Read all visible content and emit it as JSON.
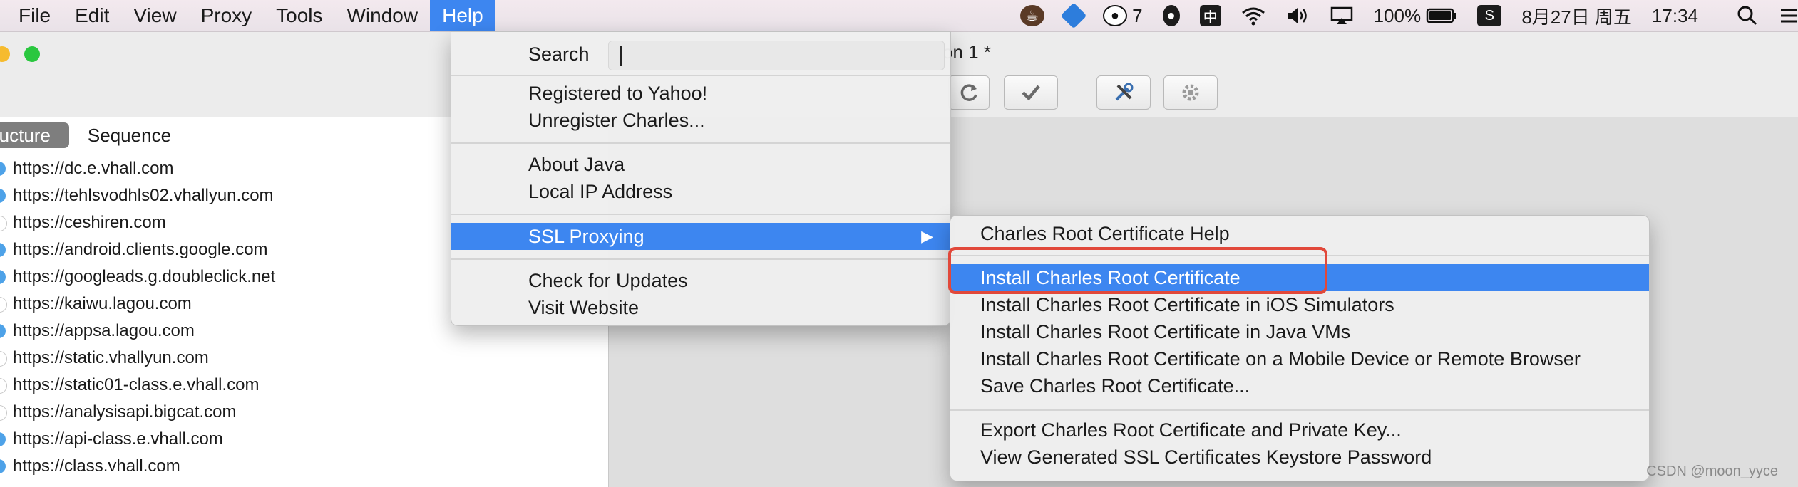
{
  "menubar": {
    "items": [
      "File",
      "Edit",
      "View",
      "Proxy",
      "Tools",
      "Window",
      "Help"
    ],
    "active_index": 6
  },
  "status_bar": {
    "wechat_count": "7",
    "battery": "100%",
    "date": "8月27日 周五",
    "time": "17:34"
  },
  "window": {
    "title": "on 1 *",
    "tabs": [
      "ructure",
      "Sequence"
    ],
    "selected_tab_index": 0
  },
  "hosts": [
    "https://dc.e.vhall.com",
    "https://tehlsvodhls02.vhallyun.com",
    "https://ceshiren.com",
    "https://android.clients.google.com",
    "https://googleads.g.doubleclick.net",
    "https://kaiwu.lagou.com",
    "https://appsa.lagou.com",
    "https://static.vhallyun.com",
    "https://static01-class.e.vhall.com",
    "https://analysisapi.bigcat.com",
    "https://api-class.e.vhall.com",
    "https://class.vhall.com"
  ],
  "help_menu": {
    "search_label": "Search",
    "registered": "Registered to Yahoo!",
    "unregister": "Unregister Charles...",
    "about_java": "About Java",
    "local_ip": "Local IP Address",
    "ssl_proxying": "SSL Proxying",
    "check_updates": "Check for Updates",
    "visit_website": "Visit Website"
  },
  "ssl_submenu": {
    "root_cert_help": "Charles Root Certificate Help",
    "install_root_cert": "Install Charles Root Certificate",
    "install_ios_sim": "Install Charles Root Certificate in iOS Simulators",
    "install_java_vms": "Install Charles Root Certificate in Java VMs",
    "install_mobile": "Install Charles Root Certificate on a Mobile Device or Remote Browser",
    "save_root_cert": "Save Charles Root Certificate...",
    "export_root_cert": "Export Charles Root Certificate and Private Key...",
    "view_keystore_password": "View Generated SSL Certificates Keystore Password"
  },
  "watermark": "CSDN @moon_yyce",
  "colors": {
    "menu_highlight": "#3d86f0",
    "annotation_box": "#e1483a"
  }
}
